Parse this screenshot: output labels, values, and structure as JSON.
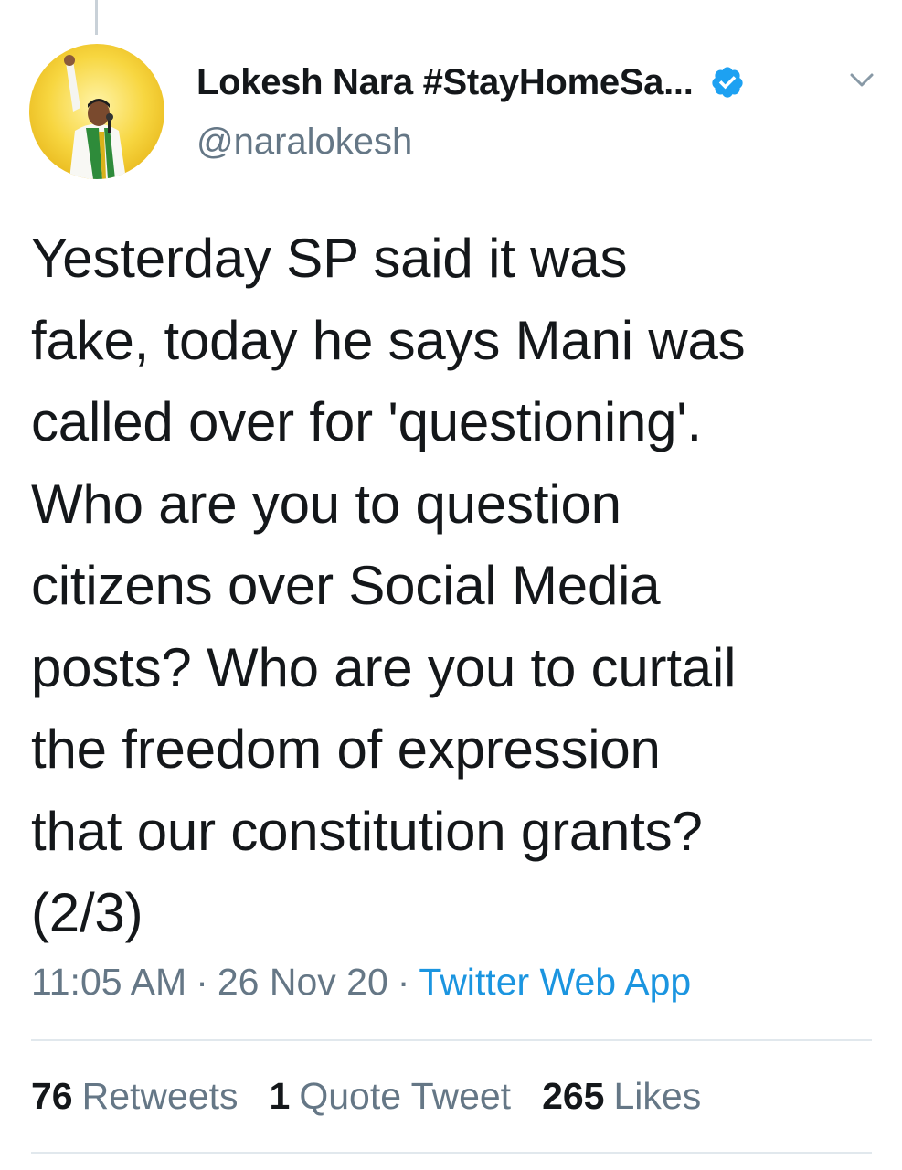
{
  "tweet": {
    "author": {
      "display_name": "Lokesh Nara #StayHomeSa...",
      "handle": "@naralokesh",
      "verified": true,
      "avatar": "profile-photo"
    },
    "text": "Yesterday SP said it was\nfake, today he says Mani was\ncalled over for 'questioning'.\nWho are you to question\ncitizens over Social Media\nposts? Who are you to curtail\nthe freedom of expression\nthat our constitution grants?\n(2/3)",
    "time": "11:05 AM",
    "separator": "·",
    "date": "26 Nov 20",
    "source": "Twitter Web App",
    "stats": {
      "retweets_count": "76",
      "retweets_label": "Retweets",
      "quotes_count": "1",
      "quotes_label": "Quote Tweet",
      "likes_count": "265",
      "likes_label": "Likes"
    }
  },
  "icons": {
    "verified": "verified-badge-icon",
    "menu": "chevron-down-icon"
  },
  "colors": {
    "text": "#14171a",
    "secondary": "#657786",
    "link": "#1b95e0",
    "divider": "#e1e8ed",
    "verified": "#1da1f2"
  }
}
